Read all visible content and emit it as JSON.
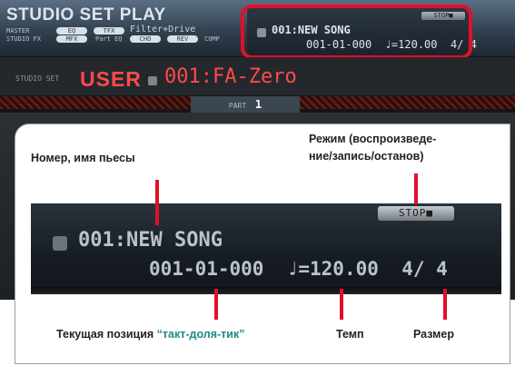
{
  "screen": {
    "title": "STUDIO SET PLAY",
    "master_label": "MASTER",
    "studio_fx_label": "STUDIO FX",
    "eq_pill": "EQ",
    "tfx_pill": "TFX",
    "mfx_pill": "MFX",
    "part_eq_label": "Part EQ",
    "cho_pill": "CHO",
    "rev_pill": "REV",
    "comp_label": "COMP",
    "filter_text": "Filter+Drive",
    "studio_set_label": "STUDIO SET",
    "studio_set_bank": "USER",
    "studio_set_name": "001:FA-Zero",
    "part_label": "PART",
    "part_number": "1"
  },
  "song_small": {
    "stop": "STOP■",
    "name": "001:NEW SONG",
    "position": "001-01-000",
    "tempo": "♩=120.00",
    "signature": "4/ 4"
  },
  "song_big": {
    "stop": "STOP■",
    "name": "001:NEW SONG",
    "position": "001-01-000",
    "tempo": "♩=120.00",
    "signature": "4/ 4"
  },
  "annotations": {
    "song_number": "Номер, имя пьесы",
    "mode_line1": "Режим (воспроизведе-",
    "mode_line2": "ние/запись/останов)",
    "position_prefix": "Текущая позиция ",
    "position_term": "“такт-доля-тик”",
    "tempo": "Темп",
    "signature": "Размер"
  },
  "colors": {
    "highlight": "#e0102a",
    "lcd_red": "#ff4a4a",
    "teal": "#1a8a86"
  }
}
